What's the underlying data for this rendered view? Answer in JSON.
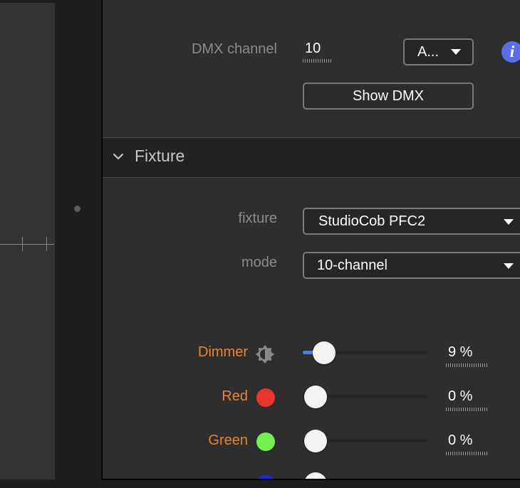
{
  "dmx": {
    "channel_label": "DMX channel",
    "channel_value": "10",
    "universe_select": "A...",
    "show_dmx_button": "Show DMX",
    "info_icon": "info-icon"
  },
  "fixture_section": {
    "header": "Fixture",
    "fixture_label": "fixture",
    "fixture_value": "StudioCob PFC2",
    "mode_label": "mode",
    "mode_value": "10-channel"
  },
  "parameters": [
    {
      "label": "Dimmer",
      "icon": "brightness-icon",
      "value_text": "9 %",
      "value": 0.09,
      "color": "#e58532"
    },
    {
      "label": "Red",
      "icon": "color-swatch",
      "swatch_color": "#e8352b",
      "value_text": "0 %",
      "value": 0
    },
    {
      "label": "Green",
      "icon": "color-swatch",
      "swatch_color": "#74f050",
      "value_text": "0 %",
      "value": 0
    }
  ],
  "colors": {
    "accent": "#3d82f5",
    "label_orange": "#e58532",
    "info_blue": "#5a6ee8"
  }
}
